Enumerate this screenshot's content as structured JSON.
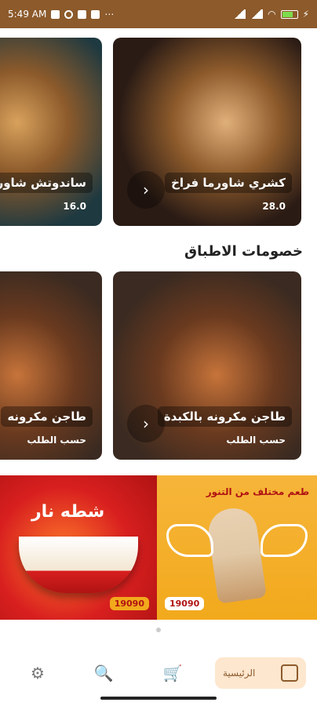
{
  "status": {
    "time": "5:49 AM"
  },
  "rows": [
    {
      "cards": [
        {
          "title": "كشري شاورما فراخ",
          "price": "28.0",
          "bg": "#3a2a21"
        },
        {
          "title": "ساندوتش شاورما",
          "price": "16.0",
          "bg": "#2c4b55"
        }
      ]
    },
    {
      "cards": [
        {
          "title": "طاجن مكرونه بالكبدة",
          "price": "حسب الطلب",
          "bg": "#3a2a21"
        },
        {
          "title": "طاجن مكرونه",
          "price": "حسب الطلب",
          "bg": "#4a2f22"
        }
      ]
    }
  ],
  "sections": {
    "discounts_title": "خصومات الاطباق"
  },
  "banner": {
    "left_text": "شطه نار",
    "right_text": "طعم مختلف من التنور",
    "phone": "19090"
  },
  "nav": {
    "home_label": "الرئيسية",
    "icons": [
      "gear-icon",
      "search-icon",
      "cart-icon",
      "home-icon"
    ]
  }
}
